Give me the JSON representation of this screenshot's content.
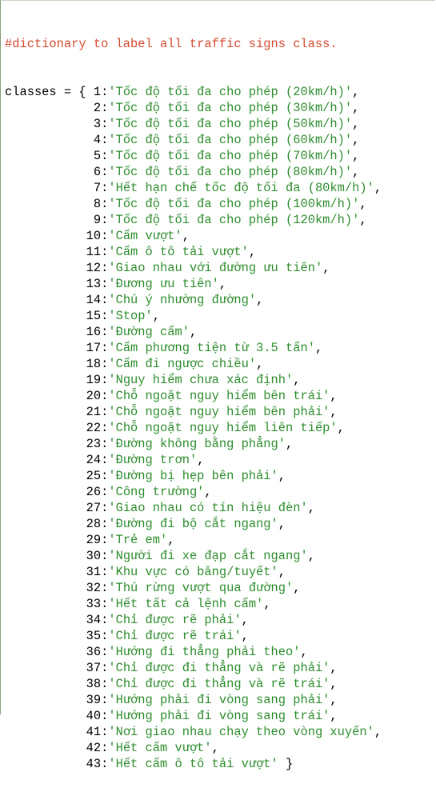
{
  "comment": "#dictionary to label all traffic signs class.",
  "code": {
    "var_name": "classes",
    "assign": " = { ",
    "close": " }",
    "entries": [
      {
        "key": "1",
        "value": "'Tốc độ tối đa cho phép (20km/h)'"
      },
      {
        "key": "2",
        "value": "'Tốc độ tối đa cho phép (30km/h)'"
      },
      {
        "key": "3",
        "value": "'Tốc độ tối đa cho phép (50km/h)'"
      },
      {
        "key": "4",
        "value": "'Tốc độ tối đa cho phép (60km/h)'"
      },
      {
        "key": "5",
        "value": "'Tốc độ tối đa cho phép (70km/h)'"
      },
      {
        "key": "6",
        "value": "'Tốc độ tối đa cho phép (80km/h)'"
      },
      {
        "key": "7",
        "value": "'Hết hạn chế tốc độ tối đa (80km/h)'"
      },
      {
        "key": "8",
        "value": "'Tốc độ tối đa cho phép (100km/h)'"
      },
      {
        "key": "9",
        "value": "'Tốc độ tối đa cho phép (120km/h)'"
      },
      {
        "key": "10",
        "value": "'Cấm vượt'"
      },
      {
        "key": "11",
        "value": "'Cấm ô tô tải vượt'"
      },
      {
        "key": "12",
        "value": "'Giao nhau với đường ưu tiên'"
      },
      {
        "key": "13",
        "value": "'Đương ưu tiên'"
      },
      {
        "key": "14",
        "value": "'Chú ý nhường đường'"
      },
      {
        "key": "15",
        "value": "'Stop'"
      },
      {
        "key": "16",
        "value": "'Đường cấm'"
      },
      {
        "key": "17",
        "value": "'Cấm phương tiện từ 3.5 tấn'"
      },
      {
        "key": "18",
        "value": "'Cấm đi ngược chiều'"
      },
      {
        "key": "19",
        "value": "'Nguy hiểm chưa xác định'"
      },
      {
        "key": "20",
        "value": "'Chỗ ngoặt nguy hiểm bên trái'"
      },
      {
        "key": "21",
        "value": "'Chỗ ngoặt nguy hiểm bên phải'"
      },
      {
        "key": "22",
        "value": "'Chỗ ngoặt nguy hiểm liên tiếp'"
      },
      {
        "key": "23",
        "value": "'Đường không bằng phẳng'"
      },
      {
        "key": "24",
        "value": "'Đường trơn'"
      },
      {
        "key": "25",
        "value": "'Đường bị hẹp bên phải'"
      },
      {
        "key": "26",
        "value": "'Công trường'"
      },
      {
        "key": "27",
        "value": "'Giao nhau có tín hiệu đèn'"
      },
      {
        "key": "28",
        "value": "'Đường đi bộ cắt ngang'"
      },
      {
        "key": "29",
        "value": "'Trẻ em'"
      },
      {
        "key": "30",
        "value": "'Người đi xe đạp cắt ngang'"
      },
      {
        "key": "31",
        "value": "'Khu vực có băng/tuyết'"
      },
      {
        "key": "32",
        "value": "'Thú rừng vượt qua đường'"
      },
      {
        "key": "33",
        "value": "'Hết tất cả lệnh cấm'"
      },
      {
        "key": "34",
        "value": "'Chỉ được rẽ phải'"
      },
      {
        "key": "35",
        "value": "'Chỉ được rẽ trái'"
      },
      {
        "key": "36",
        "value": "'Hướng đi thẳng phải theo'"
      },
      {
        "key": "37",
        "value": "'Chỉ được đi thẳng và rẽ phải'"
      },
      {
        "key": "38",
        "value": "'Chỉ được đi thẳng và rẽ trái'"
      },
      {
        "key": "39",
        "value": "'Hướng phải đi vòng sang phải'"
      },
      {
        "key": "40",
        "value": "'Hướng phải đi vòng sang trái'"
      },
      {
        "key": "41",
        "value": "'Nơi giao nhau chạy theo vòng xuyến'"
      },
      {
        "key": "42",
        "value": "'Hết cấm vượt'"
      },
      {
        "key": "43",
        "value": "'Hết cấm ô tô tải vượt'"
      }
    ]
  },
  "colors": {
    "comment": "#d4492f",
    "string": "#2d8d2d",
    "text": "#000000",
    "background": "#ffffff"
  }
}
